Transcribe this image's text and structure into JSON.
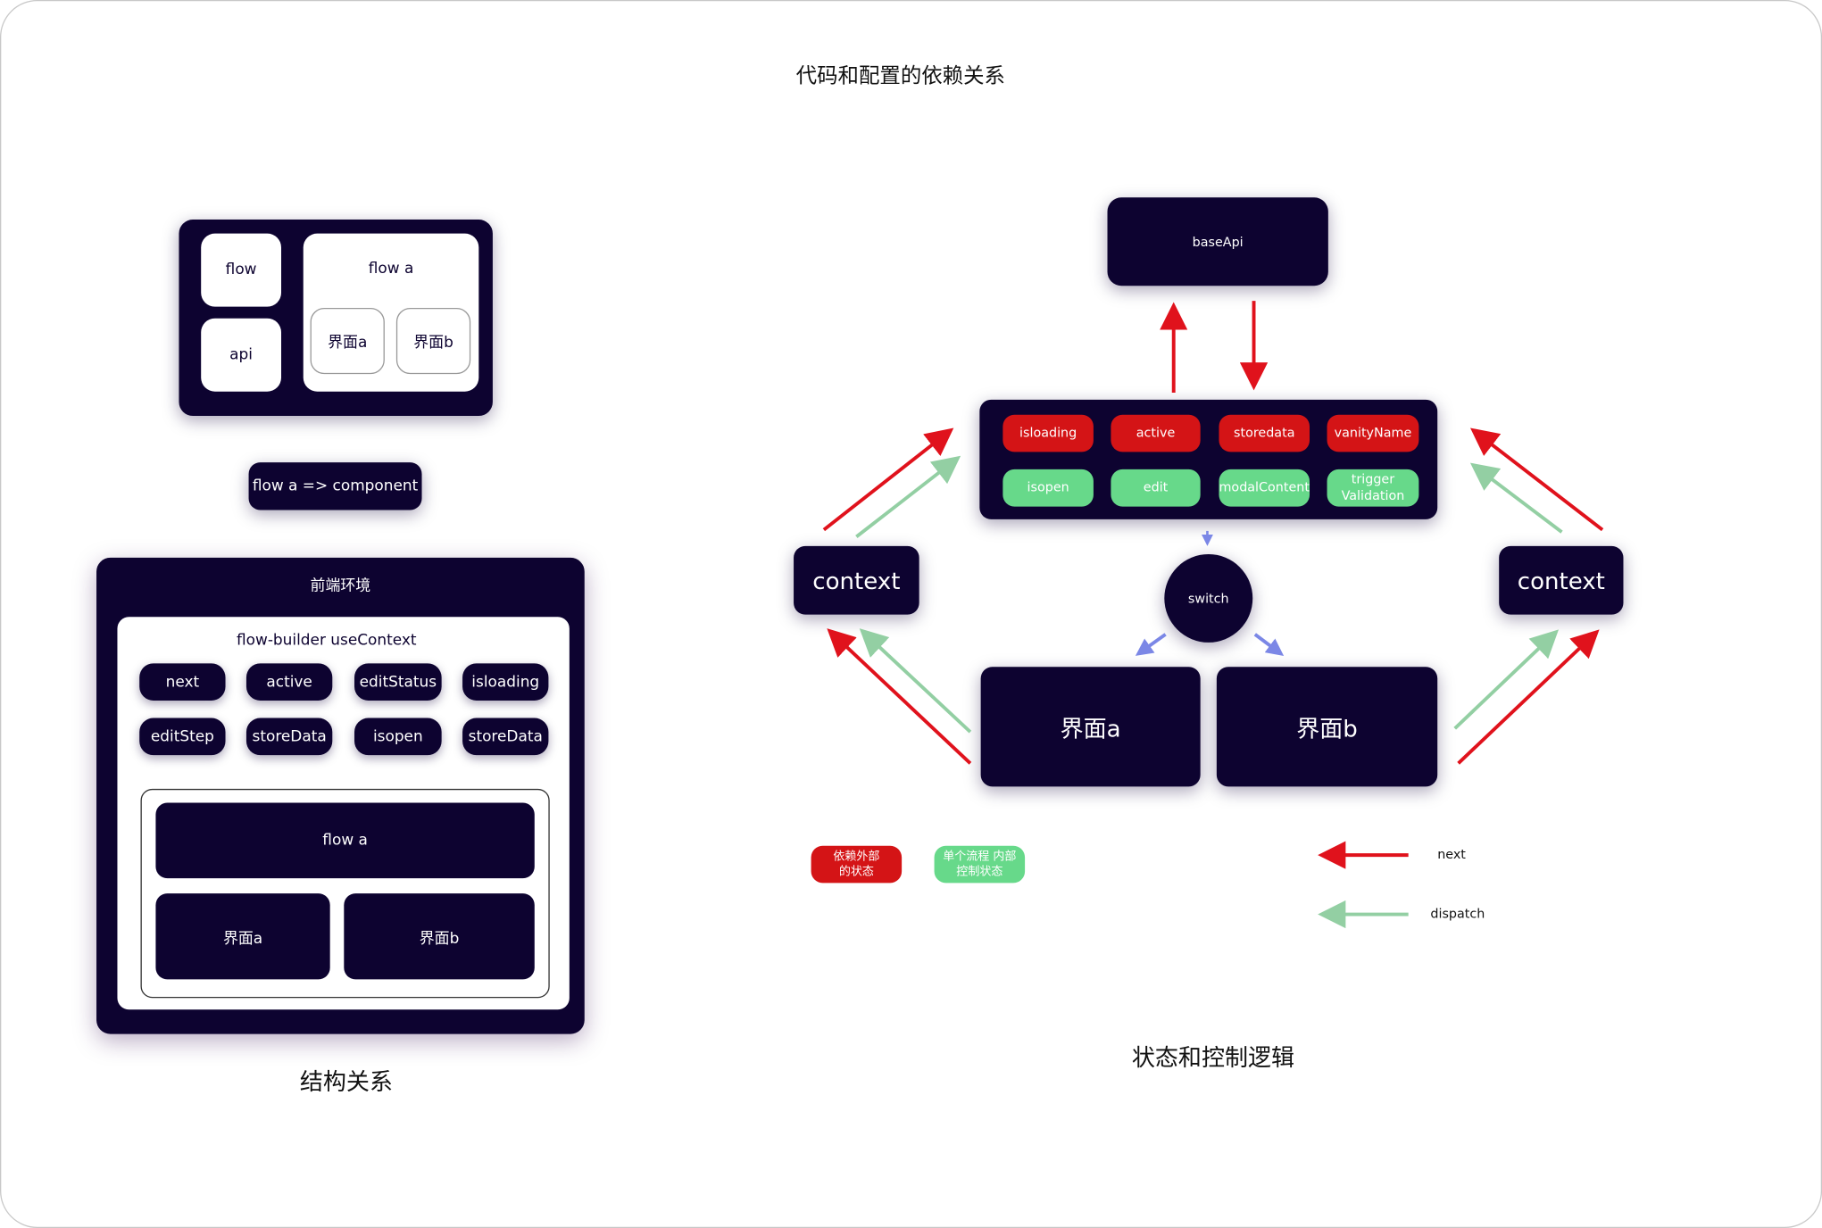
{
  "title": "代码和配置的依赖关系",
  "left": {
    "top_panel": {
      "flow": "flow",
      "api": "api",
      "flow_a": "flow a",
      "screen_a": "界面a",
      "screen_b": "界面b"
    },
    "component_label": "flow a => component",
    "frontend": {
      "title": "前端环境",
      "context_title": "flow-builder useContext",
      "items": [
        "next",
        "active",
        "editStatus",
        "isloading",
        "editStep",
        "storeData",
        "isopen",
        "storeData"
      ],
      "flow_a": "flow a",
      "screen_a": "界面a",
      "screen_b": "界面b"
    },
    "caption": "结构关系"
  },
  "right": {
    "base_api": "baseApi",
    "red_states": [
      "isloading",
      "active",
      "storedata",
      "vanityName"
    ],
    "green_states": [
      "isopen",
      "edit",
      "modalContent",
      "trigger Validation"
    ],
    "context_left": "context",
    "context_right": "context",
    "switch": "switch",
    "screen_a": "界面a",
    "screen_b": "界面b",
    "legend": {
      "external": "依赖外部 的状态",
      "internal": "单个流程 内部控制状态",
      "next": "next",
      "dispatch": "dispatch"
    },
    "caption": "状态和控制逻辑"
  },
  "colors": {
    "dark": "#0d0330",
    "red": "#d41416",
    "green": "#67d98a",
    "arrow_red": "#e0121c",
    "arrow_green": "#93cfa3",
    "arrow_blue": "#7b87e6"
  }
}
